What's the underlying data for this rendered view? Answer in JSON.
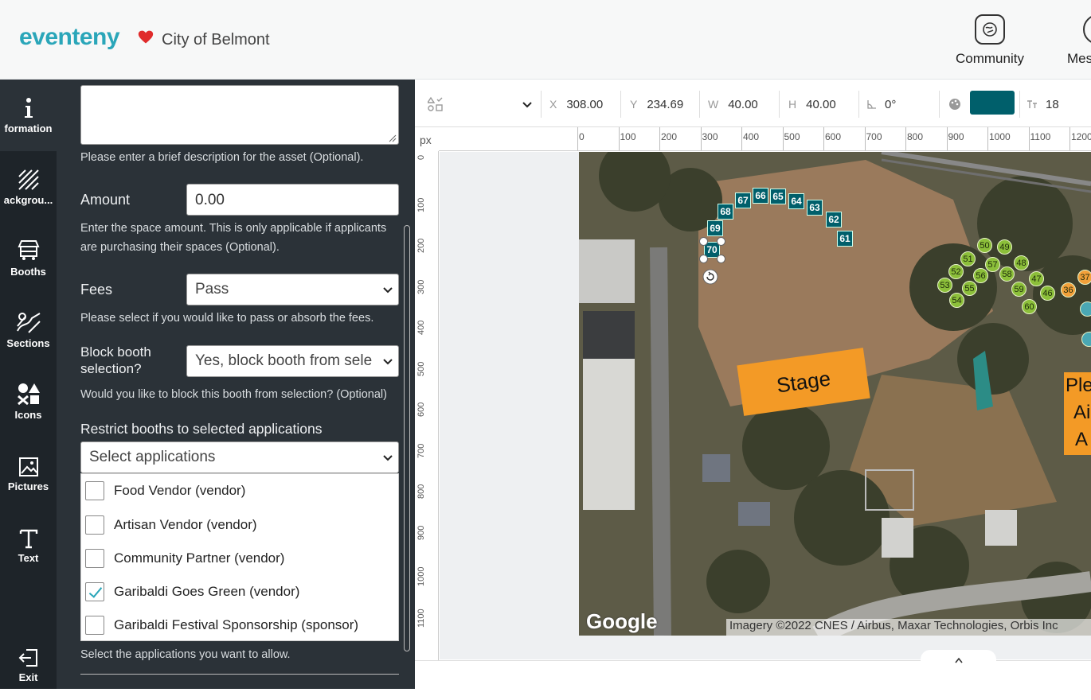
{
  "header": {
    "logo": "eventeny",
    "org": "City of Belmont",
    "nav": [
      {
        "label": "Community"
      },
      {
        "label": "Mes"
      }
    ]
  },
  "rail": {
    "items": [
      {
        "label": "formation",
        "icon": "info-icon"
      },
      {
        "label": "ackgrou...",
        "icon": "background-pattern-icon"
      },
      {
        "label": "Booths",
        "icon": "booth-icon"
      },
      {
        "label": "Sections",
        "icon": "sections-icon"
      },
      {
        "label": "Icons",
        "icon": "shapes-icon"
      },
      {
        "label": "Pictures",
        "icon": "picture-icon"
      },
      {
        "label": "Text",
        "icon": "text-icon"
      },
      {
        "label": "Exit",
        "icon": "exit-icon"
      }
    ]
  },
  "form": {
    "description_help": "Please enter a brief description for the asset (Optional).",
    "amount_label": "Amount",
    "amount_value": "0.00",
    "amount_help_1": "Enter the space amount. This is only applicable if applicants",
    "amount_help_2": "are purchasing their spaces (Optional).",
    "fees_label": "Fees",
    "fees_value": "Pass",
    "fees_help": "Please select if you would like to pass or absorb the fees.",
    "block_label_1": "Block booth",
    "block_label_2": "selection?",
    "block_value": "Yes, block booth from sele",
    "block_help": "Would you like to block this booth from selection? (Optional)",
    "restrict_label": "Restrict booths to selected applications",
    "restrict_placeholder": "Select applications",
    "applications": [
      {
        "label": "Food Vendor (vendor)",
        "checked": false
      },
      {
        "label": "Artisan Vendor (vendor)",
        "checked": false
      },
      {
        "label": "Community Partner (vendor)",
        "checked": false
      },
      {
        "label": "Garibaldi Goes Green (vendor)",
        "checked": true
      },
      {
        "label": "Garibaldi Festival Sponsorship (sponsor)",
        "checked": false
      }
    ],
    "restrict_help": "Select the applications you want to allow."
  },
  "toolbar": {
    "x_key": "X",
    "x_value": "308.00",
    "y_key": "Y",
    "y_value": "234.69",
    "w_key": "W",
    "w_value": "40.00",
    "h_key": "H",
    "h_value": "40.00",
    "angle_value": "0°",
    "fill_color": "#005f6b",
    "font_size": "18"
  },
  "rulers": {
    "unit": "px",
    "top_ticks": [
      "0",
      "100",
      "200",
      "300",
      "400",
      "500",
      "600",
      "700",
      "800",
      "900",
      "1000",
      "1100",
      "1200"
    ],
    "left_ticks": [
      "0",
      "100",
      "200",
      "300",
      "400",
      "500",
      "600",
      "700",
      "800",
      "900",
      "1000",
      "1100"
    ]
  },
  "map": {
    "stage_label": "Stage",
    "plaza_label": "Ple\nAi\nA",
    "google_label": "Google",
    "attribution": "Imagery ©2022 CNES / Airbus, Maxar Technologies, Orbis Inc",
    "square_booths": [
      "61",
      "62",
      "63",
      "64",
      "65",
      "66",
      "67",
      "68",
      "69",
      "70"
    ],
    "circle_booths": [
      "49",
      "50",
      "51",
      "52",
      "53",
      "54",
      "55",
      "56",
      "57",
      "58",
      "59",
      "60",
      "48",
      "47",
      "46",
      "36",
      "37"
    ]
  },
  "colors": {
    "accent": "#2aa6b9",
    "panel": "#2b3238",
    "rail": "#1e2429",
    "booth_teal": "#005f6b",
    "stage_orange": "#f39a26"
  }
}
